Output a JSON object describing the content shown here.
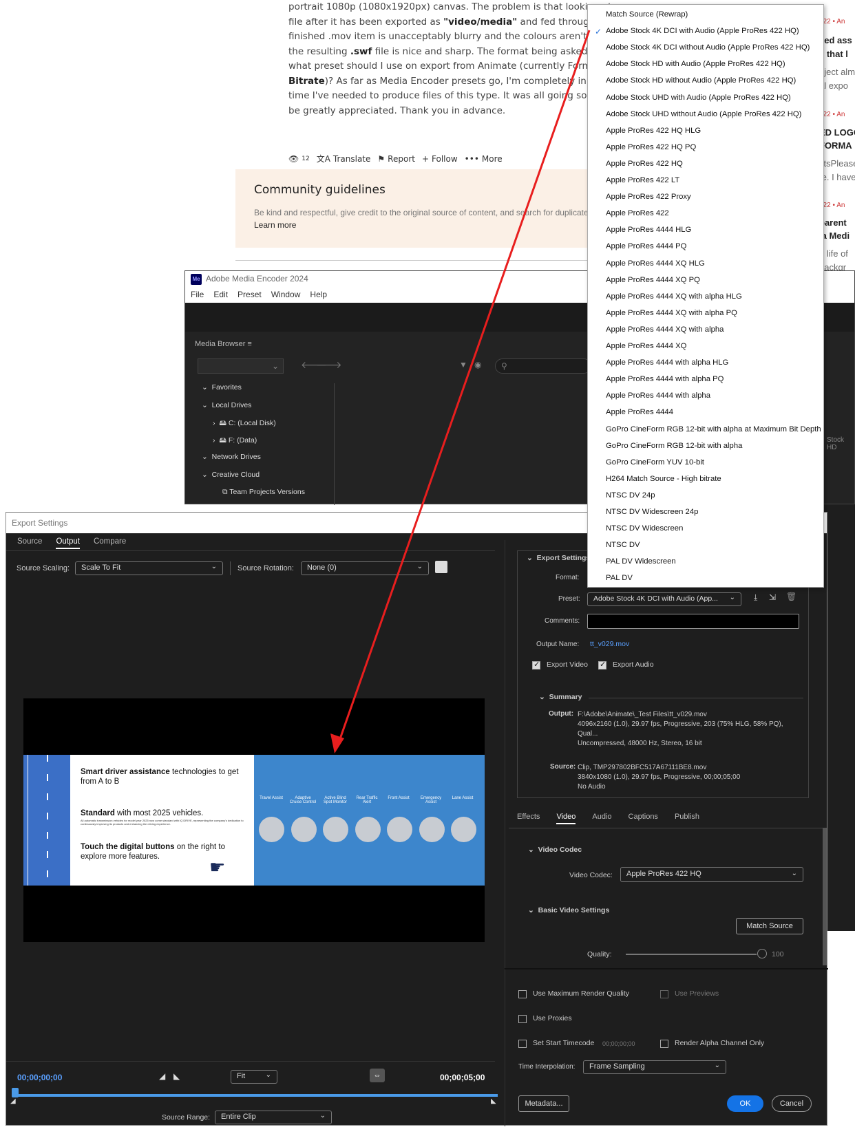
{
  "forum": {
    "lines": [
      {
        "a": "portrait 1080p (1080x1920px) canvas. The problem is that looking at the art",
        "b": "",
        "c": ""
      },
      {
        "a": "file after it has been exported as ",
        "b": "\"video/media\"",
        "c": " and fed through Media Enc"
      },
      {
        "a": "finished .mov item is unacceptably blurry and the colours aren't as vivid. If",
        "b": "",
        "c": ""
      },
      {
        "a": "the resulting ",
        "b": ".swf",
        "c": " file is nice and sharp. The format being asked for is a Quic"
      },
      {
        "a": "what preset should I use on export from Animate (currently Format: Quick",
        "b": "",
        "c": ""
      },
      {
        "a": "",
        "b": "Bitrate",
        "c": ")? As far as Media Encoder presets go, I'm completely in the dark. I h"
      },
      {
        "a": "time I've needed to produce files of this type. It was all going so well up unt",
        "b": "",
        "c": ""
      },
      {
        "a": "be greatly appreciated. Thank you in advance.",
        "b": "",
        "c": ""
      }
    ],
    "views": "12",
    "translate": "Translate",
    "report": "Report",
    "follow": "Follow",
    "more": "More",
    "guidelines_title": "Community guidelines",
    "guidelines_desc": "Be kind and respectful, give credit to the original source of content, and search for duplicates be",
    "learn_more": "Learn more",
    "side": [
      "022 • An",
      "eed ass",
      "e that l",
      "oject alm",
      "al expo",
      "022 • An",
      "ED LOGO",
      "FORMA",
      "stsPlease",
      "te. I have",
      "022 • An",
      "parent",
      "ia Medi",
      "e life of",
      "backgr"
    ]
  },
  "ame": {
    "title": "Adobe Media Encoder 2024",
    "logo": "Me",
    "menu": [
      "File",
      "Edit",
      "Preset",
      "Window",
      "Help"
    ],
    "media_browser": "Media Browser",
    "tree": [
      "Favorites",
      "Local Drives",
      "C: (Local Disk)",
      "F: (Data)",
      "Network Drives",
      "Creative Cloud",
      "Team Projects Versions"
    ],
    "stock_hd": "Stock HD"
  },
  "dropdown": {
    "selected": "Adobe Stock 4K DCI with Audio (Apple ProRes 422 HQ)",
    "items": [
      "Match Source (Rewrap)",
      "Adobe Stock 4K DCI with Audio (Apple ProRes 422 HQ)",
      "Adobe Stock 4K DCI without Audio (Apple ProRes 422 HQ)",
      "Adobe Stock HD with Audio (Apple ProRes 422 HQ)",
      "Adobe Stock HD without Audio (Apple ProRes 422 HQ)",
      "Adobe Stock UHD with Audio (Apple ProRes 422 HQ)",
      "Adobe Stock UHD without Audio (Apple ProRes 422 HQ)",
      "Apple ProRes 422 HQ HLG",
      "Apple ProRes 422 HQ PQ",
      "Apple ProRes 422 HQ",
      "Apple ProRes 422 LT",
      "Apple ProRes 422 Proxy",
      "Apple ProRes 422",
      "Apple ProRes 4444 HLG",
      "Apple ProRes 4444 PQ",
      "Apple ProRes 4444 XQ HLG",
      "Apple ProRes 4444 XQ PQ",
      "Apple ProRes 4444 XQ with alpha HLG",
      "Apple ProRes 4444 XQ with alpha PQ",
      "Apple ProRes 4444 XQ with alpha",
      "Apple ProRes 4444 XQ",
      "Apple ProRes 4444 with alpha HLG",
      "Apple ProRes 4444 with alpha PQ",
      "Apple ProRes 4444 with alpha",
      "Apple ProRes 4444",
      "GoPro CineForm RGB 12-bit with alpha at Maximum Bit Depth",
      "GoPro CineForm RGB 12-bit with alpha",
      "GoPro CineForm YUV 10-bit",
      "H264 Match Source - High bitrate",
      "NTSC DV 24p",
      "NTSC DV Widescreen 24p",
      "NTSC DV Widescreen",
      "NTSC DV",
      "PAL DV Widescreen",
      "PAL DV"
    ]
  },
  "export": {
    "title": "Export Settings",
    "tabs": [
      "Source",
      "Output",
      "Compare"
    ],
    "source_scaling_label": "Source Scaling:",
    "source_scaling": "Scale To Fit",
    "source_rotation_label": "Source Rotation:",
    "source_rotation": "None (0)",
    "preview": {
      "t1a": "Smart driver assistance",
      "t1b": " technologies to get from A to B",
      "t2a": "Standard",
      "t2b": " with most 2025 vehicles.",
      "t2small": "All automatic transmission vehicles for model year 2025 now come standard with IQ DRIVE, representing the company's dedication to continuously improving its products and enhancing the driving experience.",
      "t3a": "Touch the digital buttons",
      "t3b": " on the right to explore more features.",
      "features": [
        "Travel Assist",
        "Adaptive Cruise Control",
        "Active Blind Spot Monitor",
        "Rear Traffic Alert",
        "Front Assist",
        "Emergency Assist",
        "Lane Assist"
      ]
    },
    "timecode_start": "00;00;00;00",
    "timecode_end": "00;00;05;00",
    "fit": "Fit",
    "source_range_label": "Source Range:",
    "source_range": "Entire Clip",
    "export_settings_label": "Export Settings",
    "format_label": "Format:",
    "preset_label": "Preset:",
    "preset_value": "Adobe Stock 4K DCI with Audio (App...",
    "comments_label": "Comments:",
    "output_name_label": "Output Name:",
    "output_name": "tt_v029.mov",
    "export_video": "Export Video",
    "export_audio": "Export Audio",
    "summary_label": "Summary",
    "output_label": "Output:",
    "output_lines": [
      "F:\\Adobe\\Animate\\_Test Files\\tt_v029.mov",
      "4096x2160 (1.0), 29.97 fps, Progressive, 203 (75% HLG, 58% PQ), Qual...",
      "Uncompressed, 48000 Hz, Stereo, 16 bit"
    ],
    "source_label": "Source:",
    "source_lines": [
      "Clip, TMP297802BFC517A67111BE8.mov",
      "3840x1080 (1.0), 29.97 fps, Progressive, 00;00;05;00",
      "No Audio"
    ],
    "lower_tabs": [
      "Effects",
      "Video",
      "Audio",
      "Captions",
      "Publish"
    ],
    "video_codec_header": "Video Codec",
    "video_codec_label": "Video Codec:",
    "video_codec": "Apple ProRes 422 HQ",
    "basic_video_header": "Basic Video Settings",
    "match_source": "Match Source",
    "quality_label": "Quality:",
    "quality_value": "100",
    "quality_fraction": 1.0,
    "use_max_render": "Use Maximum Render Quality",
    "use_previews": "Use Previews",
    "use_proxies": "Use Proxies",
    "set_start_tc": "Set Start Timecode",
    "start_tc_value": "00;00;00;00",
    "render_alpha": "Render Alpha Channel Only",
    "time_interp_label": "Time Interpolation:",
    "time_interp": "Frame Sampling",
    "metadata": "Metadata...",
    "ok": "OK",
    "cancel": "Cancel"
  },
  "colors": {
    "accent": "#1473e6",
    "arrow": "#e81e1e",
    "check": "#2a72d8"
  }
}
